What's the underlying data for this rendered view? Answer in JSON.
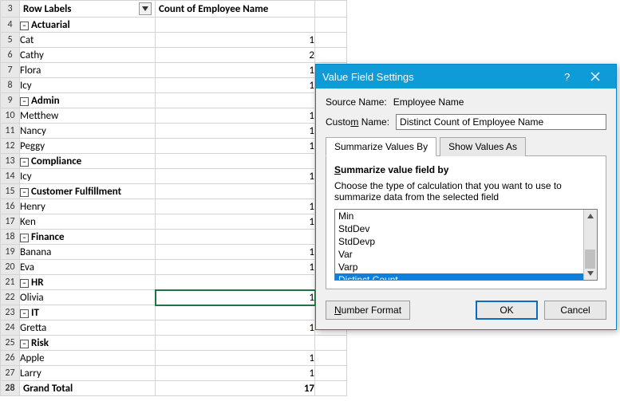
{
  "pivot": {
    "rowLabelsHeader": "Row Labels",
    "valuesHeader": "Count of Employee Name",
    "grandTotalLabel": "Grand Total",
    "grandTotalValue": "17",
    "rows": [
      {
        "type": "group",
        "label": "Actuarial",
        "value": ""
      },
      {
        "type": "item",
        "label": "Cat",
        "value": "1"
      },
      {
        "type": "item",
        "label": "Cathy",
        "value": "2"
      },
      {
        "type": "item",
        "label": "Flora",
        "value": "1"
      },
      {
        "type": "item",
        "label": "Icy",
        "value": "1"
      },
      {
        "type": "group",
        "label": "Admin",
        "value": ""
      },
      {
        "type": "item",
        "label": "Metthew",
        "value": "1"
      },
      {
        "type": "item",
        "label": "Nancy",
        "value": "1"
      },
      {
        "type": "item",
        "label": "Peggy",
        "value": "1"
      },
      {
        "type": "group",
        "label": "Compliance",
        "value": ""
      },
      {
        "type": "item",
        "label": "Icy",
        "value": "1"
      },
      {
        "type": "group",
        "label": "Customer Fulfillment",
        "value": ""
      },
      {
        "type": "item",
        "label": "Henry",
        "value": "1"
      },
      {
        "type": "item",
        "label": "Ken",
        "value": "1"
      },
      {
        "type": "group",
        "label": "Finance",
        "value": ""
      },
      {
        "type": "item",
        "label": "Banana",
        "value": "1"
      },
      {
        "type": "item",
        "label": "Eva",
        "value": "1"
      },
      {
        "type": "group",
        "label": "HR",
        "value": ""
      },
      {
        "type": "item",
        "label": "Olivia",
        "value": "1"
      },
      {
        "type": "group",
        "label": "IT",
        "value": ""
      },
      {
        "type": "item",
        "label": "Gretta",
        "value": "1"
      },
      {
        "type": "group",
        "label": "Risk",
        "value": ""
      },
      {
        "type": "item",
        "label": "Apple",
        "value": "1"
      },
      {
        "type": "item",
        "label": "Larry",
        "value": "1"
      }
    ],
    "startRow": 3
  },
  "activeCellRowNum": 22,
  "dialog": {
    "title": "Value Field Settings",
    "sourceNameLabel": "Source Name:",
    "sourceNameValue": "Employee Name",
    "customNameLabel": "Custom Name:",
    "customNameValue": "Distinct Count of Employee Name",
    "tabs": {
      "summarize": "Summarize Values By",
      "showAs": "Show Values As"
    },
    "sectionTitle": "Summarize value field by",
    "sectionDesc": "Choose the type of calculation that you want to use to summarize data from the selected field",
    "options": [
      "Min",
      "StdDev",
      "StdDevp",
      "Var",
      "Varp",
      "Distinct Count"
    ],
    "selectedOption": "Distinct Count",
    "buttons": {
      "numberFormat": "Number Format",
      "ok": "OK",
      "cancel": "Cancel"
    }
  }
}
